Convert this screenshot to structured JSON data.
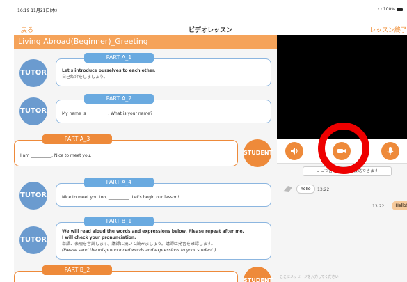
{
  "status_bar": {
    "time": "16:19 11月21日(木)",
    "battery": "100%"
  },
  "nav": {
    "back": "戻る",
    "title": "ビデオレッスン",
    "end": "レッスン終了"
  },
  "lesson_title": "Living Abroad(Beginner)_Greeting",
  "roles": {
    "tutor": "TUTOR",
    "student": "STUDENT"
  },
  "parts": {
    "a1": {
      "label": "PART A_1",
      "en": "Let's introduce ourselves to each other.",
      "jp": "自己紹介をしましょう。"
    },
    "a2": {
      "label": "PART A_2",
      "text": "My name is __________. What is your name?"
    },
    "a3": {
      "label": "PART A_3",
      "text": "I am __________. Nice to meet you."
    },
    "a4": {
      "label": "PART A_4",
      "text": "Nice to meet you too, __________. Let's begin our lesson!"
    },
    "b1": {
      "label": "PART B_1",
      "en1": "We will read aloud the words and expressions below. Please repeat after me.",
      "en2": "I will check your pronunciation.",
      "jp": "単語、表現を音読します。講師に続いて読みましょう。講師は発音を確認します。",
      "note": "(Please send the mispronounced words and expressions to your student.)"
    },
    "b2": {
      "label": "PART B_2"
    }
  },
  "chat": {
    "banner": "ここで音声と文字で会話できます",
    "messages": [
      {
        "text": "hello",
        "time": "13:22"
      },
      {
        "text": "Hello!",
        "time": "13:22"
      }
    ],
    "input_placeholder": "ここにメッセージを入力してください"
  },
  "controls": [
    "speaker-icon",
    "camera-icon",
    "microphone-icon"
  ],
  "colors": {
    "accent": "#ee8a3a",
    "tutor": "#6b9bcf",
    "tab_blue": "#6aaae0",
    "highlight": "#ee0000"
  }
}
